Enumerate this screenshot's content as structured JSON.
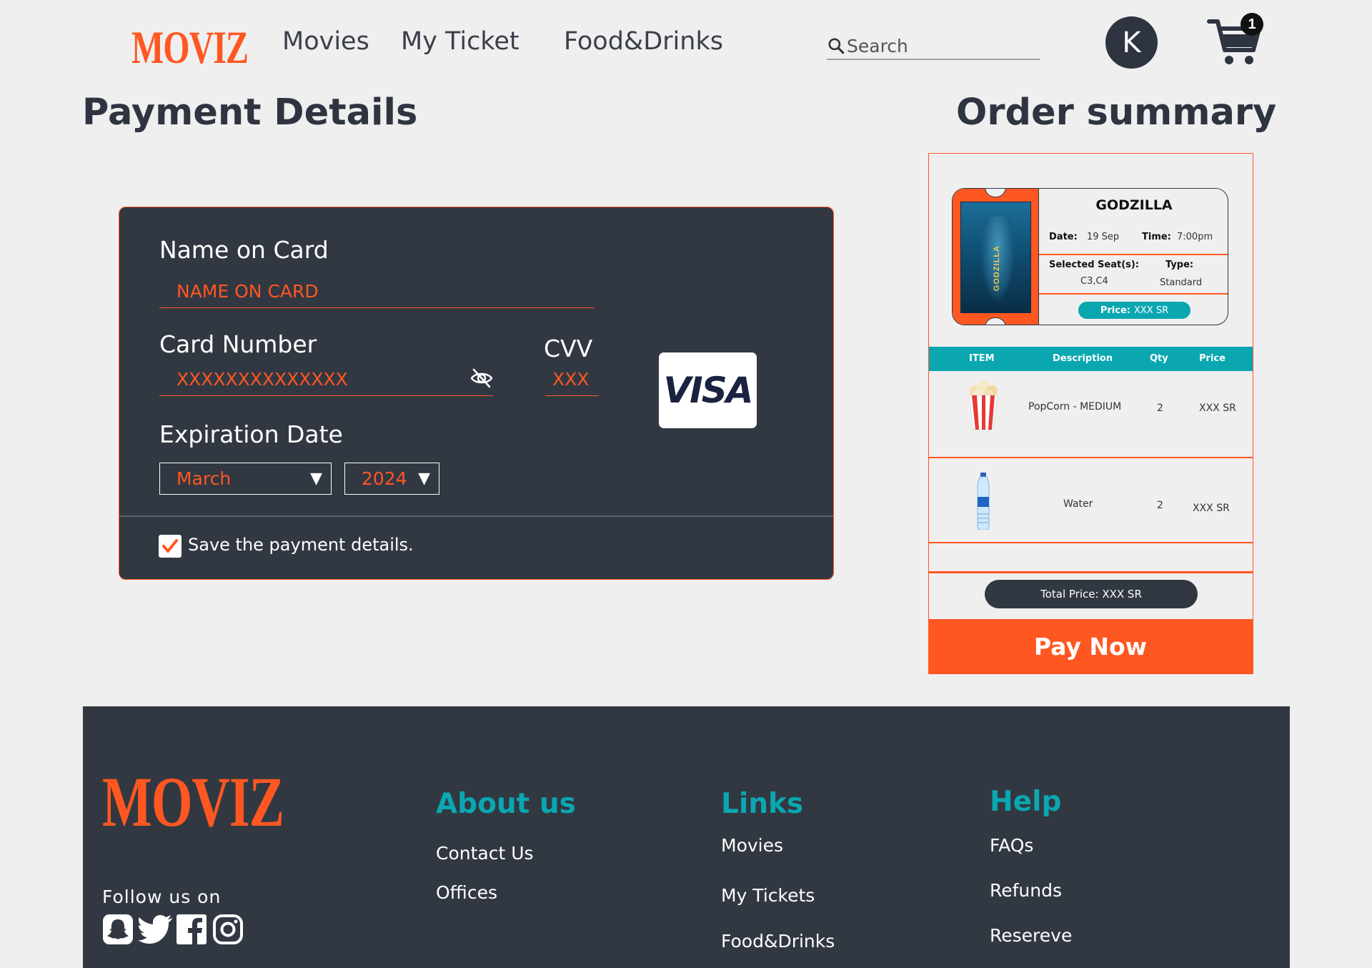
{
  "header": {
    "logo": "MOVIZ",
    "nav": [
      "Movies",
      "My Ticket",
      "Food&Drinks"
    ],
    "search_placeholder": "Search",
    "avatar_initial": "K",
    "cart_count": "1"
  },
  "headings": {
    "payment": "Payment Details",
    "order": "Order summary"
  },
  "payment": {
    "name_label": "Name on Card",
    "name_placeholder": "NAME ON CARD",
    "card_label": "Card Number",
    "card_placeholder": "XXXXXXXXXXXXXX",
    "cvv_label": "CVV",
    "cvv_placeholder": "XXX",
    "card_brand": "VISA",
    "exp_label": "Expiration Date",
    "exp_month": "March",
    "exp_year": "2024",
    "save_label": "Save the payment details.",
    "save_checked": true
  },
  "ticket": {
    "title": "GODZILLA",
    "poster_text": "GODZILLA",
    "date_label": "Date:",
    "date_value": "19 Sep",
    "time_label": "Time:",
    "time_value": "7:00pm",
    "seats_label": "Selected Seat(s):",
    "seats_value": "C3,C4",
    "type_label": "Type:",
    "type_value": "Standard",
    "price_label": "Price:",
    "price_value": "XXX SR"
  },
  "order_table": {
    "headers": [
      "ITEM",
      "Description",
      "Qty",
      "Price"
    ],
    "rows": [
      {
        "icon": "popcorn-icon",
        "description": "PopCorn - MEDIUM",
        "qty": "2",
        "price": "XXX SR"
      },
      {
        "icon": "water-bottle-icon",
        "description": "Water",
        "qty": "2",
        "price": "XXX SR"
      }
    ]
  },
  "order": {
    "total": "Total Price: XXX SR",
    "pay_button": "Pay Now"
  },
  "footer": {
    "logo": "MOVIZ",
    "follow": "Follow us on",
    "social": [
      "snapchat-icon",
      "twitter-icon",
      "facebook-icon",
      "instagram-icon"
    ],
    "about_title": "About us",
    "about_links": [
      "Contact Us",
      "Offices"
    ],
    "links_title": "Links",
    "links": [
      "Movies",
      "My Tickets",
      "Food&Drinks"
    ],
    "help_title": "Help",
    "help_links": [
      "FAQs",
      "Refunds",
      "Resereve"
    ]
  },
  "colors": {
    "accent": "#ff5722",
    "teal": "#0aa7b1",
    "dark": "#313842",
    "background": "#efefef"
  }
}
